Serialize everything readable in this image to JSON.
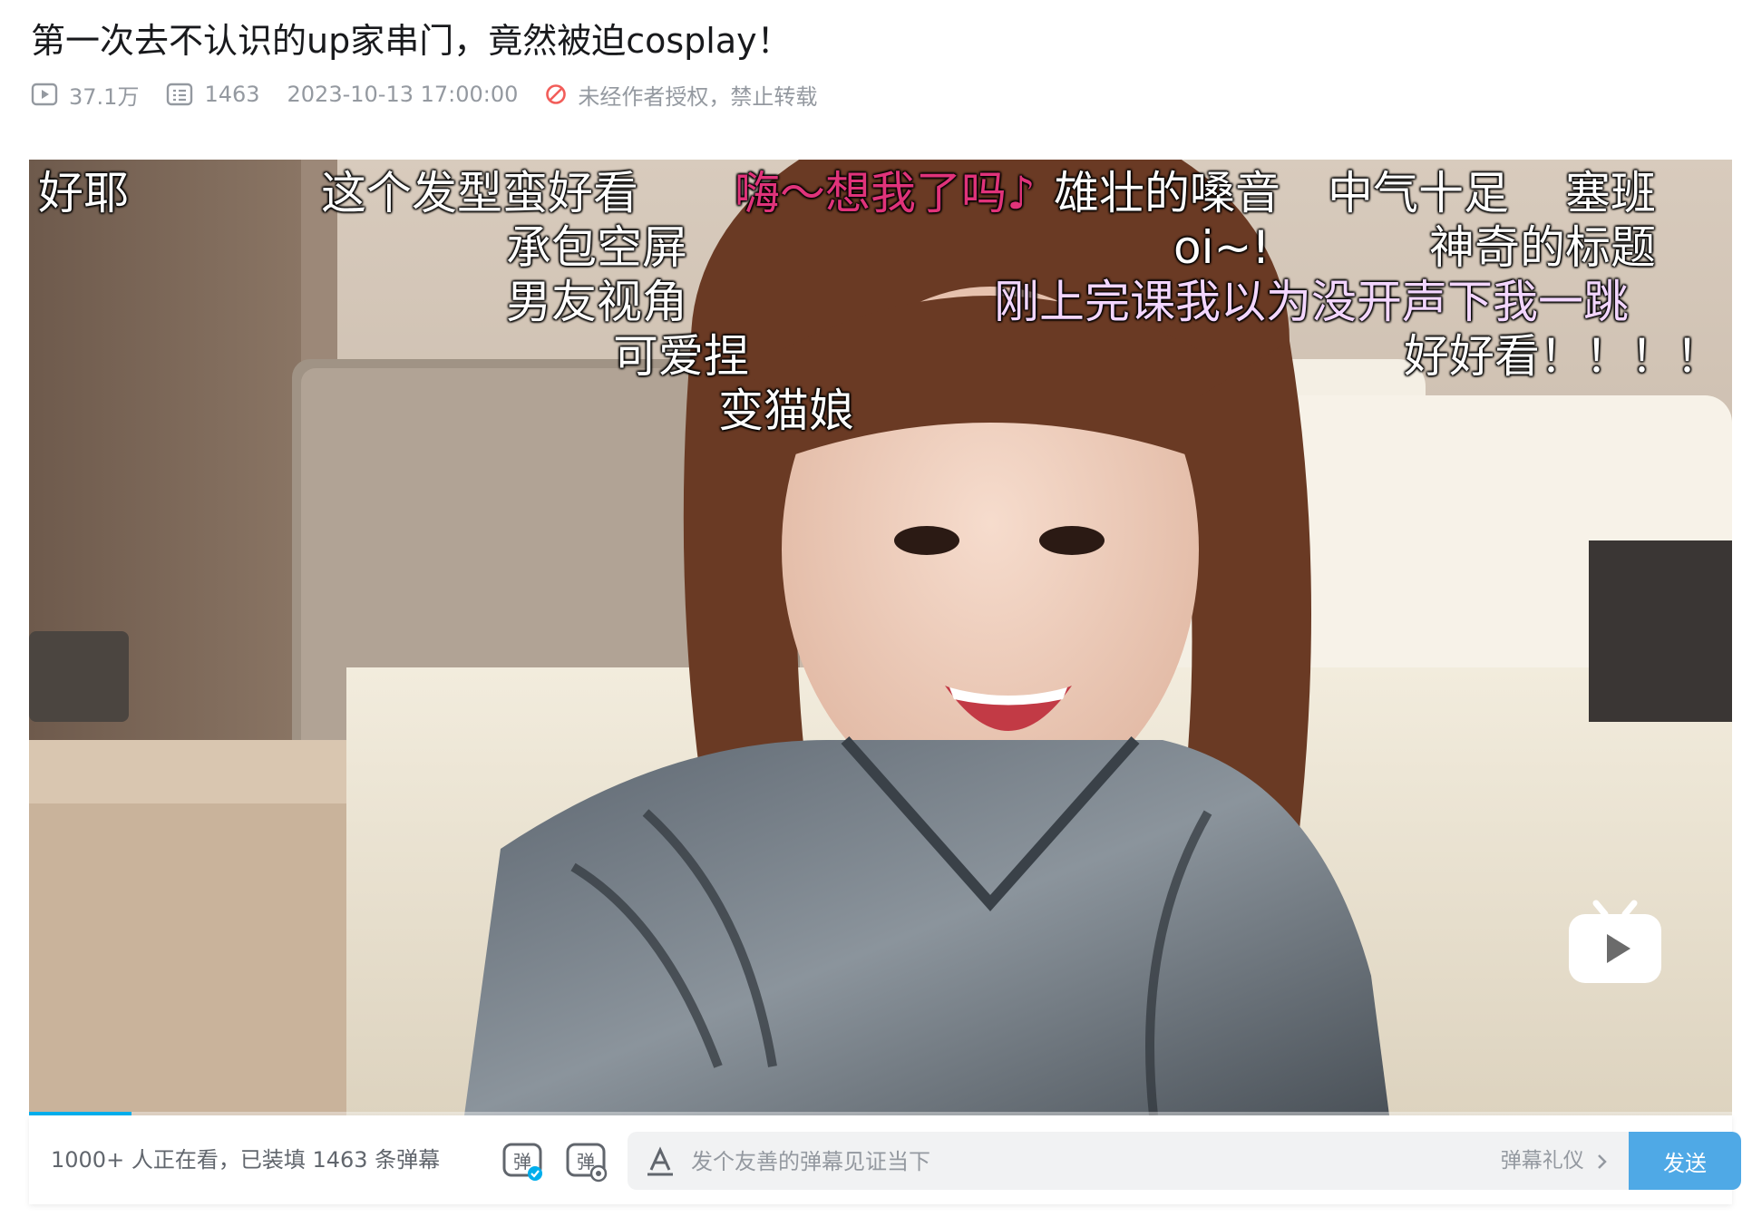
{
  "video": {
    "title": "第一次去不认识的up家串门，竟然被迫cosplay！",
    "views": "37.1万",
    "danmaku_count": "1463",
    "published": "2023-10-13 17:00:00",
    "copyright_notice": "未经作者授权，禁止转载",
    "progress": 0.06
  },
  "danmaku": [
    {
      "text": "好耶",
      "color": "#ffffff"
    },
    {
      "text": "这个发型蛮好看",
      "color": "#ffffff"
    },
    {
      "text": "嗨～想我了吗♪",
      "color": "#e0337a"
    },
    {
      "text": "雄壮的嗓音",
      "color": "#ffffff"
    },
    {
      "text": "中气十足",
      "color": "#ffffff"
    },
    {
      "text": "塞班",
      "color": "#ffffff"
    },
    {
      "text": "承包空屏",
      "color": "#ffffff"
    },
    {
      "text": "oi~!",
      "color": "#ffffff"
    },
    {
      "text": "神奇的标题",
      "color": "#ffffff"
    },
    {
      "text": "男友视角",
      "color": "#ffffff"
    },
    {
      "text": "刚上完课我以为没开声下我一跳",
      "color": "#f3d6ff"
    },
    {
      "text": "可爱捏",
      "color": "#ffffff"
    },
    {
      "text": "好好看！！！！",
      "color": "#ffffff"
    },
    {
      "text": "变猫娘",
      "color": "#ffffff"
    }
  ],
  "danmaku_bar": {
    "watching_text": "1000+ 人正在看，已装填 1463 条弹幕",
    "input_placeholder": "发个友善的弹幕见证当下",
    "etiquette_label": "弹幕礼仪",
    "send_label": "发送"
  },
  "icons": {
    "views": "play-count-icon",
    "danmaku": "danmaku-count-icon",
    "copyright": "no-repost-icon",
    "danmaku_toggle": "danmaku-toggle-icon",
    "danmaku_settings": "danmaku-settings-icon",
    "font_style": "font-style-icon",
    "chevron": "chevron-right-icon",
    "logo": "bilibili-tv-icon"
  },
  "colors": {
    "accent": "#00aeec",
    "send_button": "#4fa9e6",
    "no_repost": "#f25d59"
  }
}
